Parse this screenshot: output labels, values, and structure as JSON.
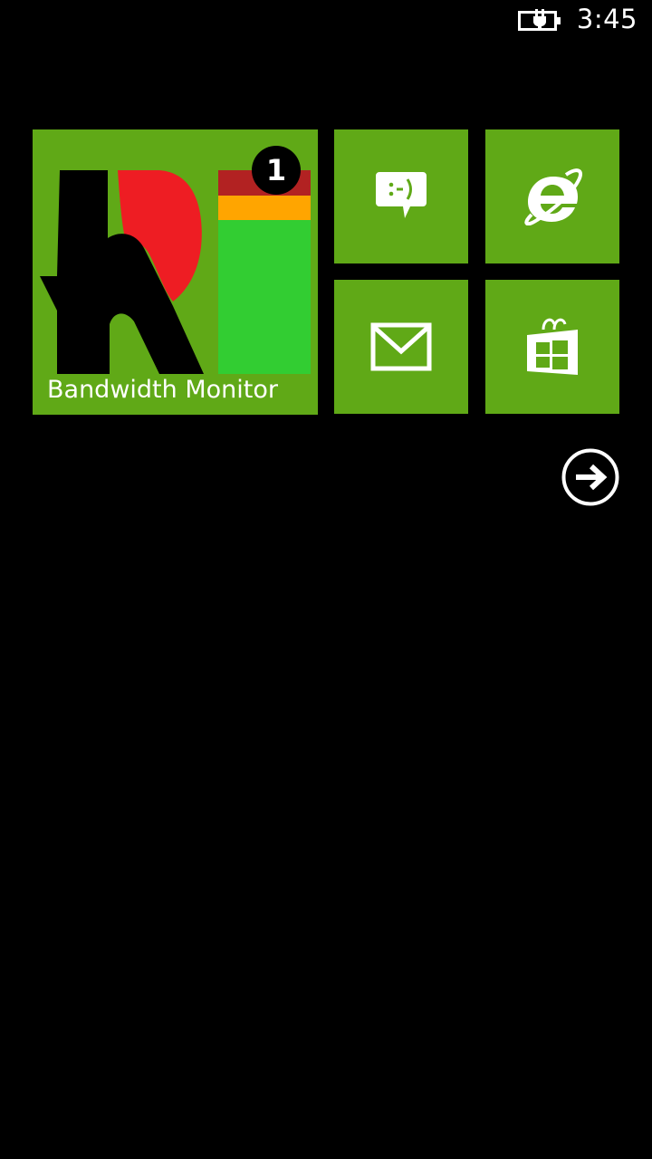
{
  "status": {
    "time": "3:45",
    "battery_icon": "battery-charging-icon"
  },
  "tiles": {
    "wide": {
      "label": "Bandwidth Monitor",
      "badge": "1",
      "icon": "bandwidth-monitor-logo"
    },
    "messaging": {
      "icon": "messaging-icon"
    },
    "browser": {
      "icon": "internet-explorer-icon"
    },
    "mail": {
      "icon": "mail-icon"
    },
    "store": {
      "icon": "store-icon"
    }
  },
  "navigation": {
    "icon": "arrow-right-circle-icon"
  },
  "colors": {
    "accent": "#60a917",
    "background": "#000000"
  }
}
